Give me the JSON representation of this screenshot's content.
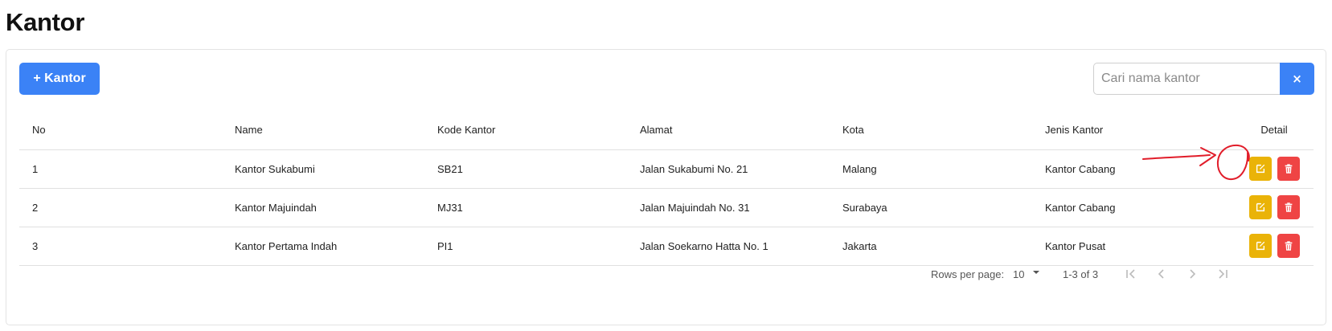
{
  "page": {
    "title": "Kantor"
  },
  "toolbar": {
    "add_label": "+ Kantor",
    "search_placeholder": "Cari nama kantor",
    "search_value": "",
    "clear_label": "×"
  },
  "table": {
    "headers": {
      "no": "No",
      "name": "Name",
      "kode": "Kode Kantor",
      "alamat": "Alamat",
      "kota": "Kota",
      "jenis": "Jenis Kantor",
      "detail": "Detail"
    },
    "rows": [
      {
        "no": "1",
        "name": "Kantor Sukabumi",
        "kode": "SB21",
        "alamat": "Jalan Sukabumi No. 21",
        "kota": "Malang",
        "jenis": "Kantor Cabang"
      },
      {
        "no": "2",
        "name": "Kantor Majuindah",
        "kode": "MJ31",
        "alamat": "Jalan Majuindah No. 31",
        "kota": "Surabaya",
        "jenis": "Kantor Cabang"
      },
      {
        "no": "3",
        "name": "Kantor Pertama Indah",
        "kode": "PI1",
        "alamat": "Jalan Soekarno Hatta No. 1",
        "kota": "Jakarta",
        "jenis": "Kantor Pusat"
      }
    ],
    "row_actions": [
      "edit-icon",
      "trash-icon"
    ]
  },
  "pagination": {
    "rows_per_page_label": "Rows per page:",
    "rows_per_page_value": "10",
    "range_text": "1-3 of 3",
    "nav_icons": [
      "first-page-icon",
      "prev-page-icon",
      "next-page-icon",
      "last-page-icon"
    ]
  },
  "colors": {
    "primary": "#3b82f6",
    "edit": "#eab308",
    "delete": "#ef4444",
    "annotation": "#e11d2a"
  }
}
